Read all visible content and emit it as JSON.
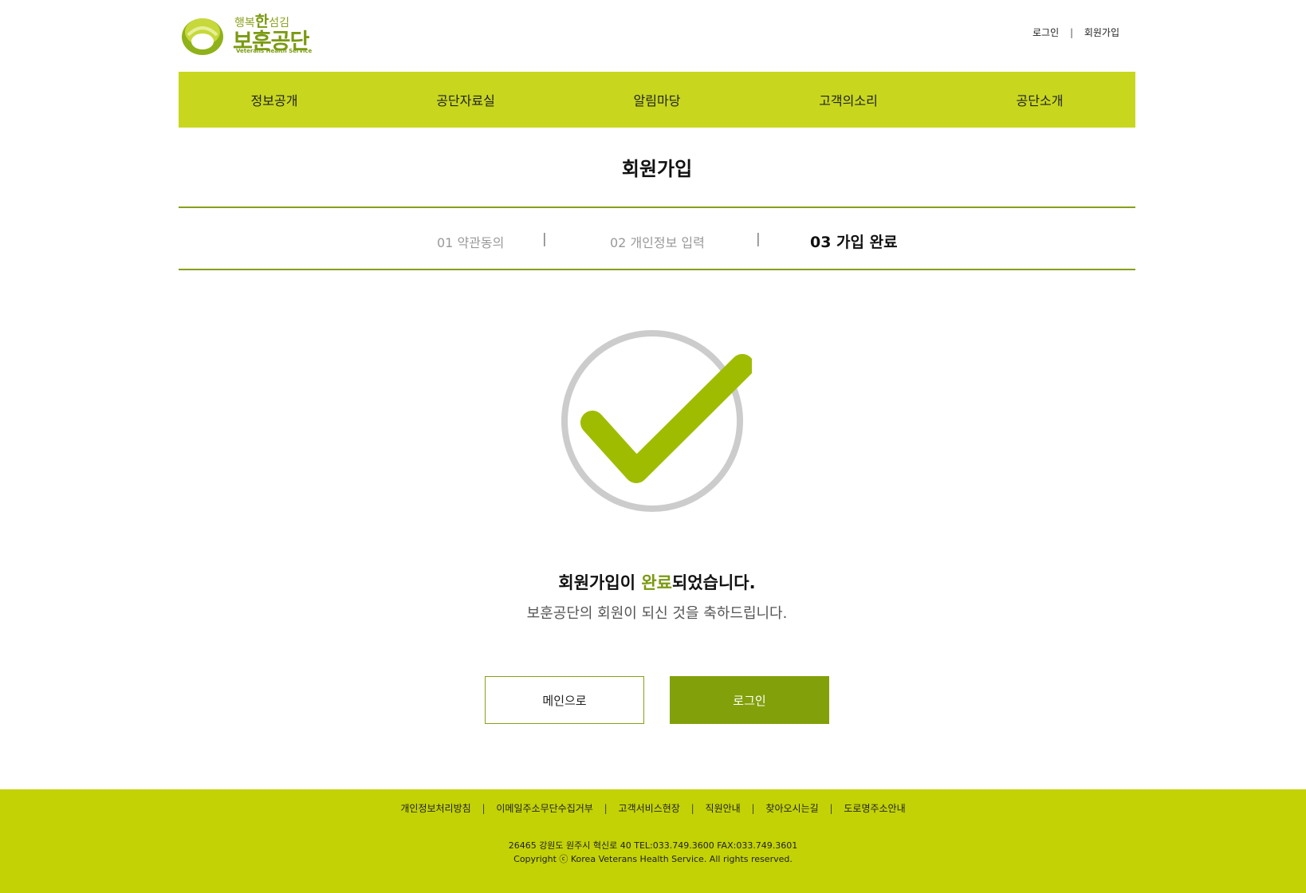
{
  "header": {
    "logo": {
      "tagline_pre": "행복",
      "tagline_big": "한",
      "tagline_post": "섬김",
      "name": "보훈공단",
      "subtitle": "Veterans Health Service"
    },
    "util": {
      "login": "로그인",
      "separator": "|",
      "signup": "회원가입"
    }
  },
  "nav": {
    "items": [
      {
        "label": "정보공개"
      },
      {
        "label": "공단자료실"
      },
      {
        "label": "알림마당"
      },
      {
        "label": "고객의소리"
      },
      {
        "label": "공단소개"
      }
    ]
  },
  "main": {
    "title": "회원가입",
    "steps": [
      {
        "label": "01 약관동의",
        "active": false
      },
      {
        "label": "02 개인정보 입력",
        "active": false
      },
      {
        "label": "03 가입 완료",
        "active": true
      }
    ],
    "step_separator": "|",
    "message": {
      "pre": "회원가입이 ",
      "highlight": "완료",
      "post": "되었습니다.",
      "sub": "보훈공단의 회원이 되신 것을 축하드립니다."
    },
    "buttons": {
      "main": "메인으로",
      "login": "로그인"
    }
  },
  "footer": {
    "links": [
      "개인정보처리방침",
      "이메일주소무단수집거부",
      "고객서비스현장",
      "직원안내",
      "찾아오시는길",
      "도로명주소안내"
    ],
    "link_separator": "|",
    "address": "26465 강원도 원주시 혁신로 40 TEL:033.749.3600 FAX:033.749.3601",
    "copyright": "Copyright ⓒ Korea Veterans Health Service. All rights reserved."
  },
  "colors": {
    "brand_green": "#c8d71e",
    "dark_green": "#82a00a",
    "check_green": "#a0bc00",
    "ring_gray": "#cccccc"
  },
  "icons": {
    "logo": "veterans-health-logo-icon",
    "check": "check-circle-icon"
  }
}
